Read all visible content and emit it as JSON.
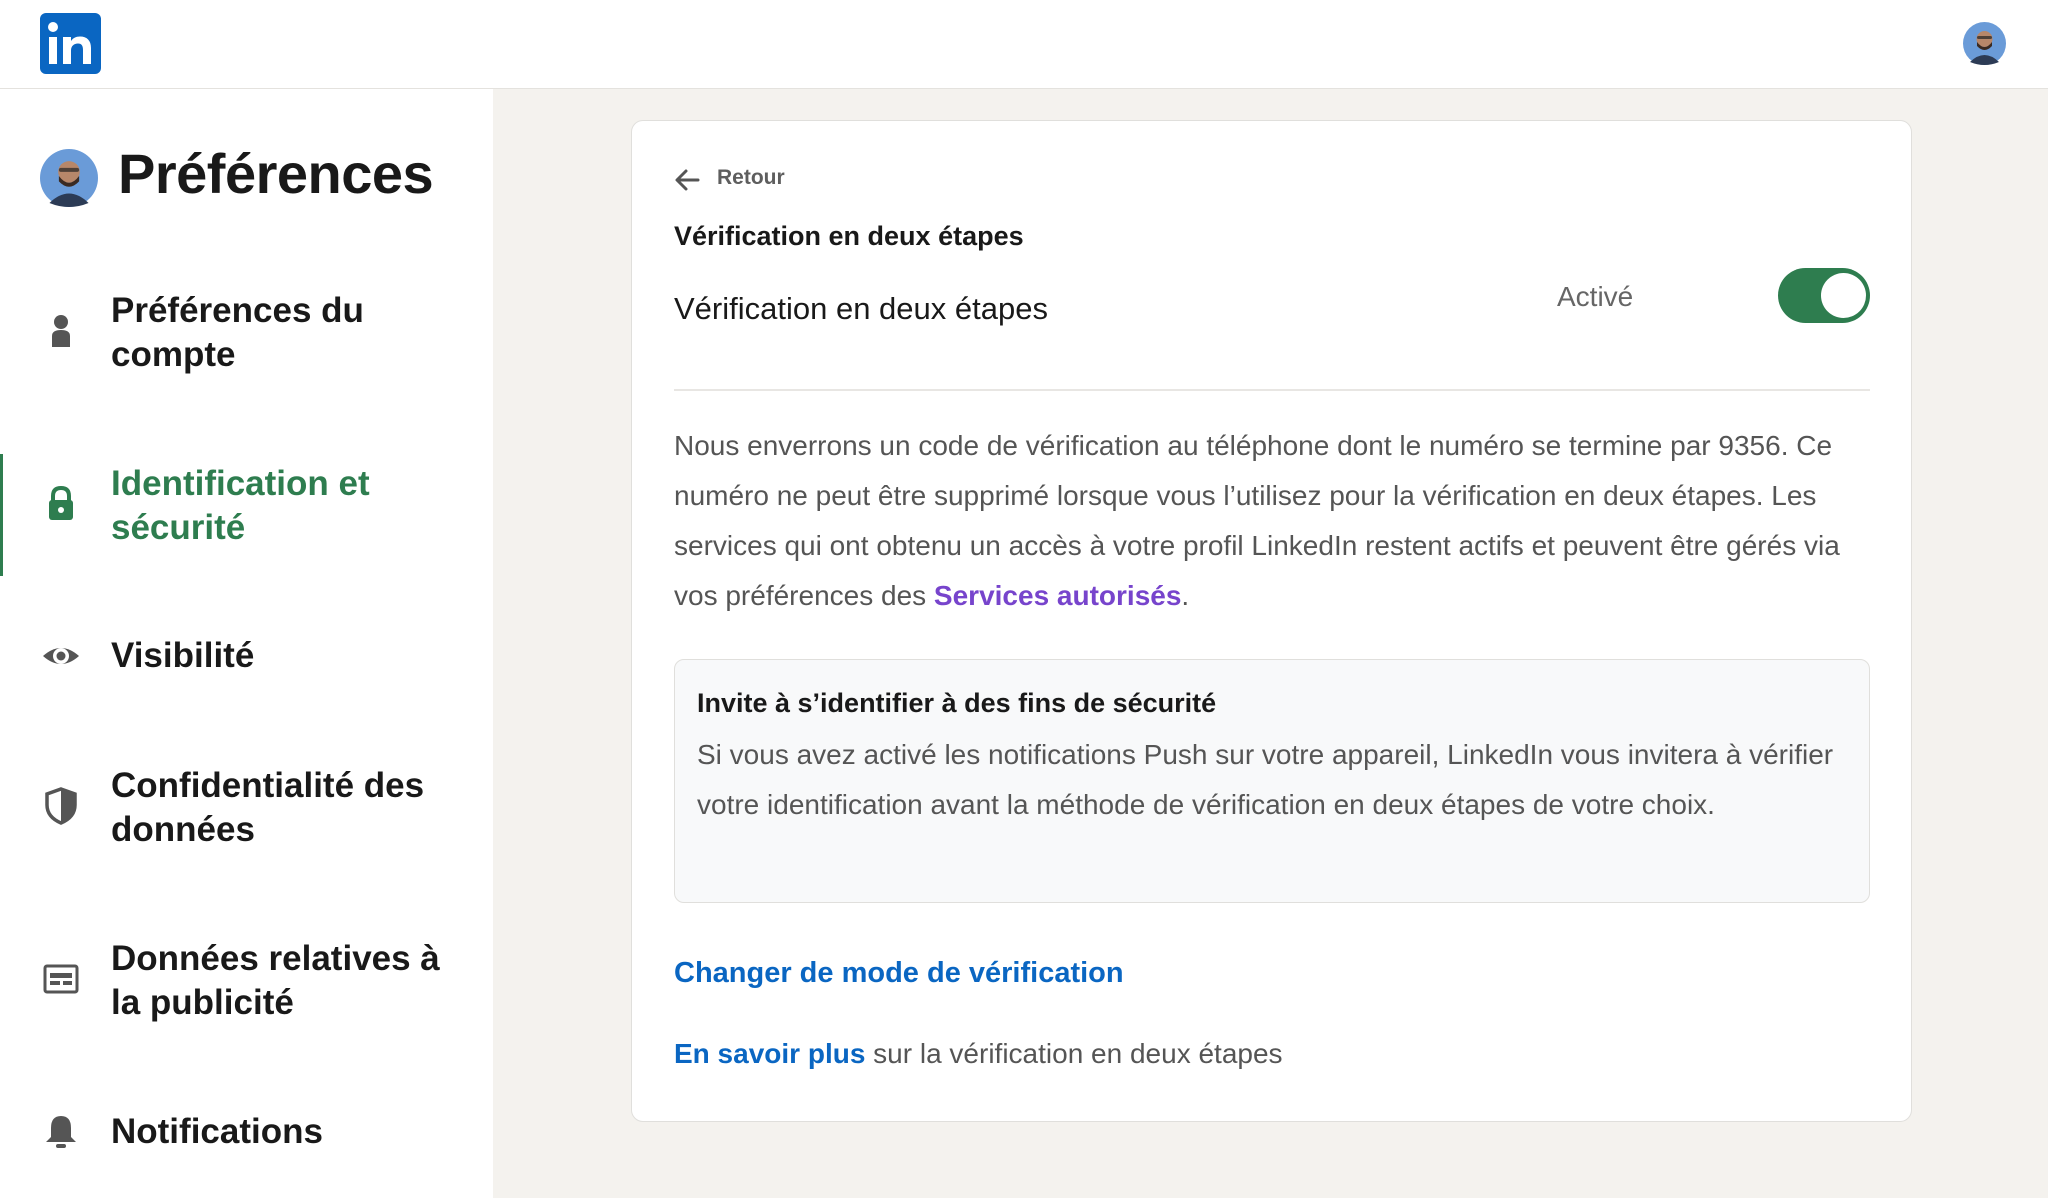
{
  "app": {
    "logo": "linkedin-logo",
    "logo_text": "in"
  },
  "sidebar": {
    "title": "Préférences",
    "items": [
      {
        "label": "Préférences du compte",
        "icon": "person-icon",
        "active": false
      },
      {
        "label": "Identification et sécurité",
        "icon": "lock-icon",
        "active": true
      },
      {
        "label": "Visibilité",
        "icon": "eye-icon",
        "active": false
      },
      {
        "label": "Confidentialité des données",
        "icon": "shield-icon",
        "active": false
      },
      {
        "label": "Données relatives à la publicité",
        "icon": "ad-card-icon",
        "active": false
      },
      {
        "label": "Notifications",
        "icon": "bell-icon",
        "active": false
      }
    ]
  },
  "main": {
    "back_label": "Retour",
    "section_title": "Vérification en deux étapes",
    "setting_label": "Vérification en deux étapes",
    "status": "Activé",
    "toggle_on": true,
    "description": {
      "text": "Nous enverrons un code de vérification au téléphone dont le numéro se termine par 9356. Ce numéro ne peut être supprimé lorsque vous l’utilisez pour la vérification en deux étapes. Les services qui ont obtenu un accès à votre profil LinkedIn restent actifs et peuvent être gérés via vos préférences des ",
      "link": "Services autorisés",
      "suffix": "."
    },
    "info_box": {
      "title": "Invite à s’identifier à des fins de sécurité",
      "text": "Si vous avez activé les notifications Push sur votre appareil, LinkedIn vous invitera à vérifier votre identification avant la méthode de vérification en deux étapes de votre choix."
    },
    "change_link": "Changer de mode de vérification",
    "learn_more": {
      "link": "En savoir plus",
      "text": " sur la vérification en deux étapes"
    }
  },
  "colors": {
    "accent_green": "#2e7d4f",
    "link_blue": "#0a66c2",
    "link_purple": "#7744cc",
    "brand": "#0a66c2"
  }
}
